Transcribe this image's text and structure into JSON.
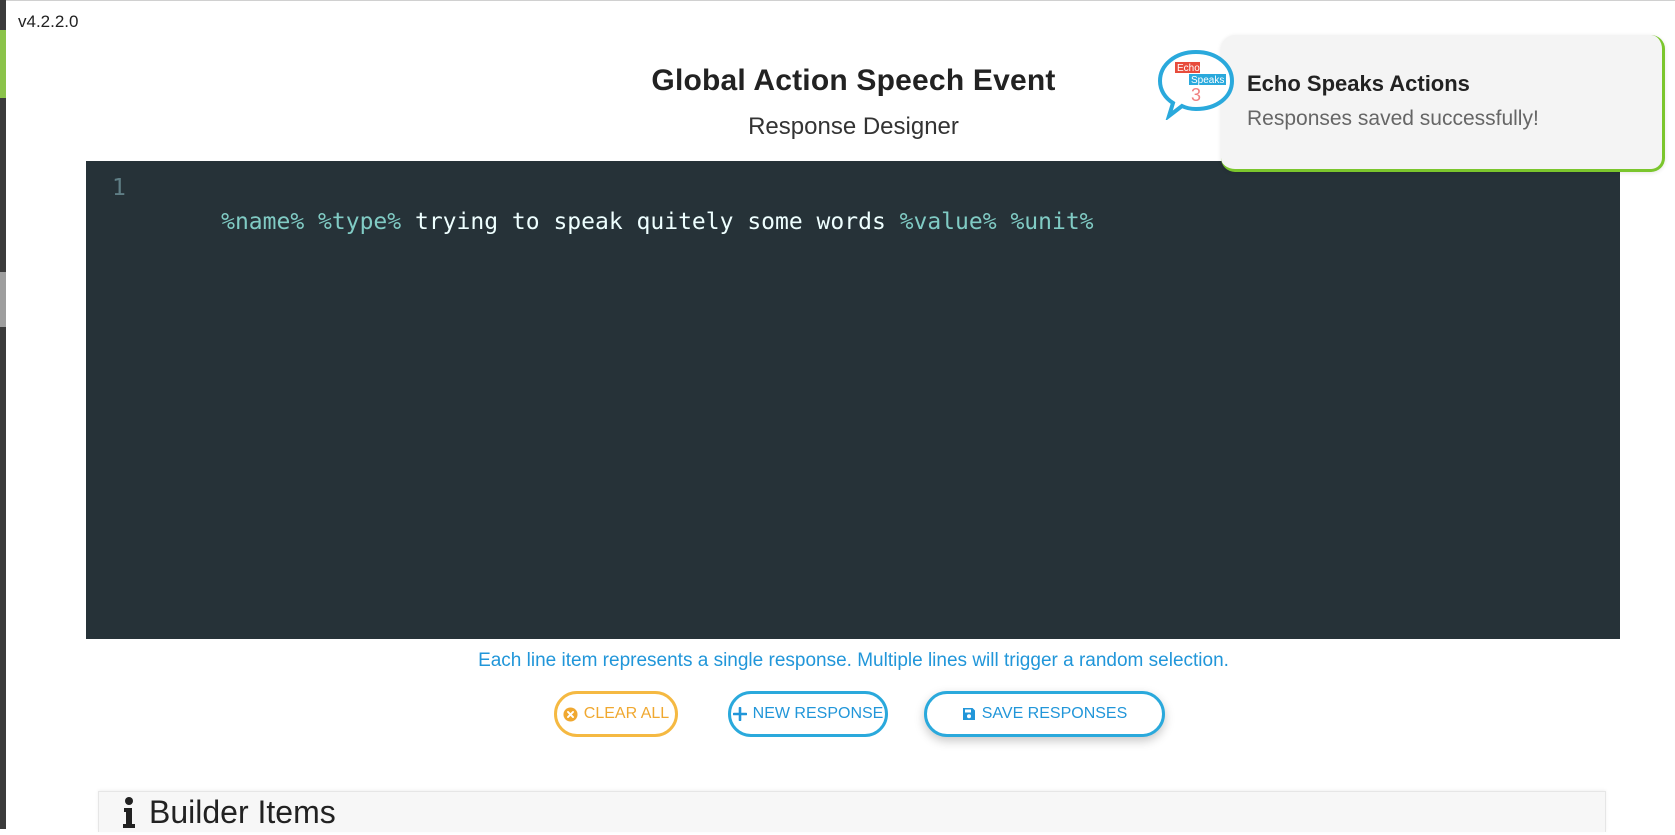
{
  "app": {
    "version": "v4.2.2.0",
    "title": "Global Action Speech Event",
    "subtitle": "Response Designer"
  },
  "editor": {
    "lines": [
      {
        "number": "1",
        "tokens": [
          {
            "text": "%name%",
            "kind": "var"
          },
          {
            "text": " ",
            "kind": "text"
          },
          {
            "text": "%type%",
            "kind": "var"
          },
          {
            "text": " trying to speak quitely some words ",
            "kind": "text"
          },
          {
            "text": "%value%",
            "kind": "var"
          },
          {
            "text": " ",
            "kind": "text"
          },
          {
            "text": "%unit%",
            "kind": "var"
          }
        ]
      }
    ]
  },
  "hint": "Each line item represents a single response. Multiple lines will trigger a random selection.",
  "buttons": {
    "clear_all": "CLEAR ALL",
    "new_response": "NEW RESPONSE",
    "save_responses": "SAVE RESPONSES"
  },
  "builder": {
    "title": "Builder Items",
    "icon": "info-icon"
  },
  "toast": {
    "title": "Echo Speaks Actions",
    "message": "Responses saved successfully!",
    "logo_text_top": "Echo",
    "logo_text_mid": "Speaks",
    "logo_text_num": "3",
    "accent": "#7bc62d"
  },
  "colors": {
    "editor_bg": "#263238",
    "variable": "#80cbc4",
    "code_text": "#eeffff",
    "hint": "#2196d9",
    "clear_btn": "#f5b942",
    "primary_btn": "#2aa9dc"
  }
}
